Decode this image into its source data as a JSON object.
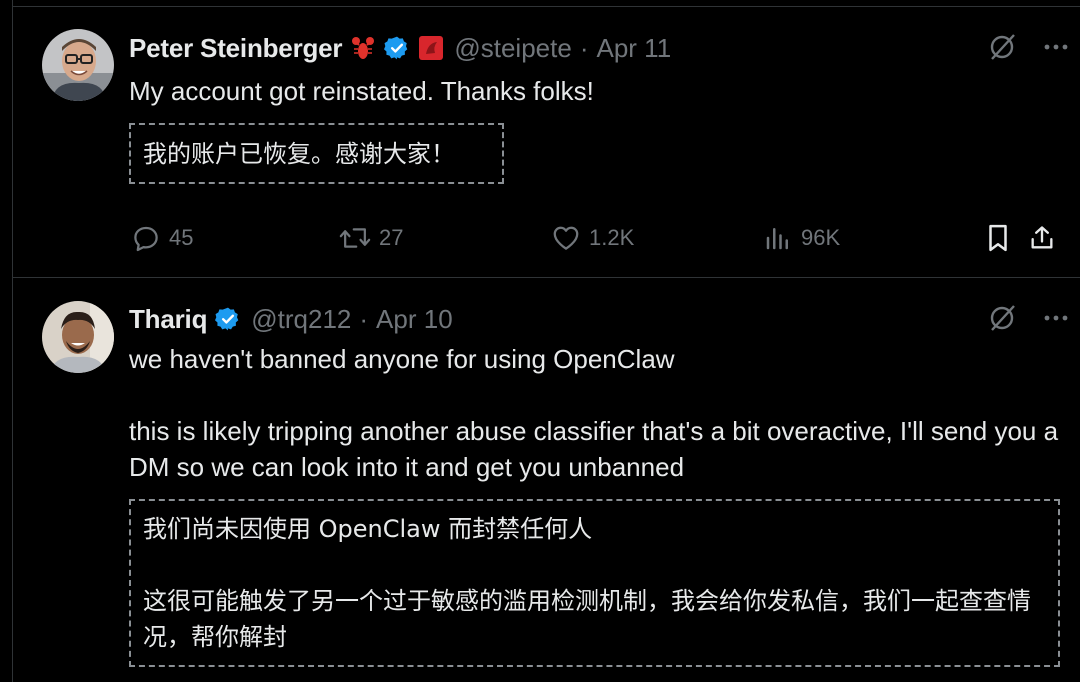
{
  "tweets": [
    {
      "author": "Peter Steinberger",
      "handle": "@steipete",
      "separator": "·",
      "date": "Apr 11",
      "text": "My account got reinstated. Thanks folks!",
      "translation": "我的账户已恢复。感谢大家！",
      "stats": {
        "replies": "45",
        "reposts": "27",
        "likes": "1.2K",
        "views": "96K"
      }
    },
    {
      "author": "Thariq",
      "handle": "@trq212",
      "separator": "·",
      "date": "Apr 10",
      "text": "we haven't banned anyone for using OpenClaw\n\nthis is likely tripping another abuse classifier that's a bit overactive, I'll send you a DM so we can look into it and get you unbanned",
      "translation": "我们尚未因使用 OpenClaw 而封禁任何人\n\n这很可能触发了另一个过于敏感的滥用检测机制，我会给你发私信，我们一起查查情况，帮你解封"
    }
  ],
  "colors": {
    "background": "#000000",
    "text": "#e7e9ea",
    "muted": "#71767b",
    "verified": "#1d9bf0",
    "divider": "#2f3336"
  },
  "icons": [
    "lobster-emoji",
    "verified-badge-icon",
    "flag-badge-icon",
    "grok-icon",
    "more-icon",
    "reply-icon",
    "retweet-icon",
    "like-icon",
    "views-icon",
    "bookmark-icon",
    "share-icon"
  ]
}
